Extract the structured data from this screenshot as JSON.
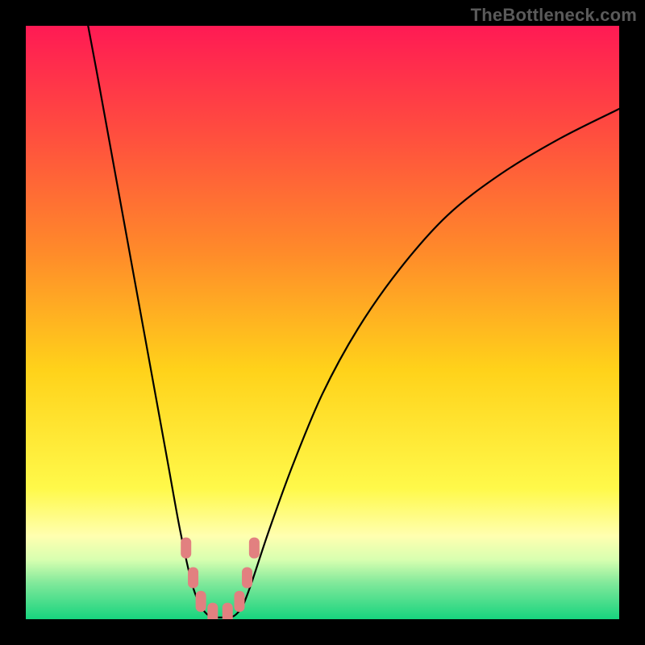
{
  "watermark": "TheBottleneck.com",
  "chart_data": {
    "type": "line",
    "title": "",
    "xlabel": "",
    "ylabel": "",
    "xlim": [
      0,
      100
    ],
    "ylim": [
      0,
      100
    ],
    "grid": false,
    "legend": false,
    "background_gradient": {
      "stops": [
        {
          "offset": 0.0,
          "color": "#ff1a54"
        },
        {
          "offset": 0.18,
          "color": "#ff4d3f"
        },
        {
          "offset": 0.38,
          "color": "#ff8a2a"
        },
        {
          "offset": 0.58,
          "color": "#ffd21a"
        },
        {
          "offset": 0.78,
          "color": "#fff94a"
        },
        {
          "offset": 0.86,
          "color": "#ffffb0"
        },
        {
          "offset": 0.9,
          "color": "#d7ffb0"
        },
        {
          "offset": 0.94,
          "color": "#7fe89a"
        },
        {
          "offset": 1.0,
          "color": "#17d47e"
        }
      ]
    },
    "series": [
      {
        "name": "left-branch",
        "x": [
          10.5,
          12,
          14,
          16,
          18,
          20,
          22,
          24,
          26,
          28,
          29.5
        ],
        "y": [
          100,
          92,
          81,
          70,
          59,
          48,
          37,
          26,
          15,
          6,
          2
        ]
      },
      {
        "name": "valley-floor",
        "x": [
          29.5,
          31,
          33,
          35,
          36.5
        ],
        "y": [
          2,
          0.5,
          0.3,
          0.5,
          2
        ]
      },
      {
        "name": "right-branch",
        "x": [
          36.5,
          38,
          41,
          45,
          50,
          56,
          63,
          71,
          80,
          90,
          100
        ],
        "y": [
          2,
          6,
          15,
          26,
          38,
          49,
          59,
          68,
          75,
          81,
          86
        ]
      }
    ],
    "markers": {
      "name": "valley-markers",
      "color": "#e28080",
      "points": [
        {
          "x": 27.0,
          "y": 12
        },
        {
          "x": 28.2,
          "y": 7
        },
        {
          "x": 29.5,
          "y": 3
        },
        {
          "x": 31.5,
          "y": 1
        },
        {
          "x": 34.0,
          "y": 1
        },
        {
          "x": 36.0,
          "y": 3
        },
        {
          "x": 37.3,
          "y": 7
        },
        {
          "x": 38.5,
          "y": 12
        }
      ]
    }
  }
}
